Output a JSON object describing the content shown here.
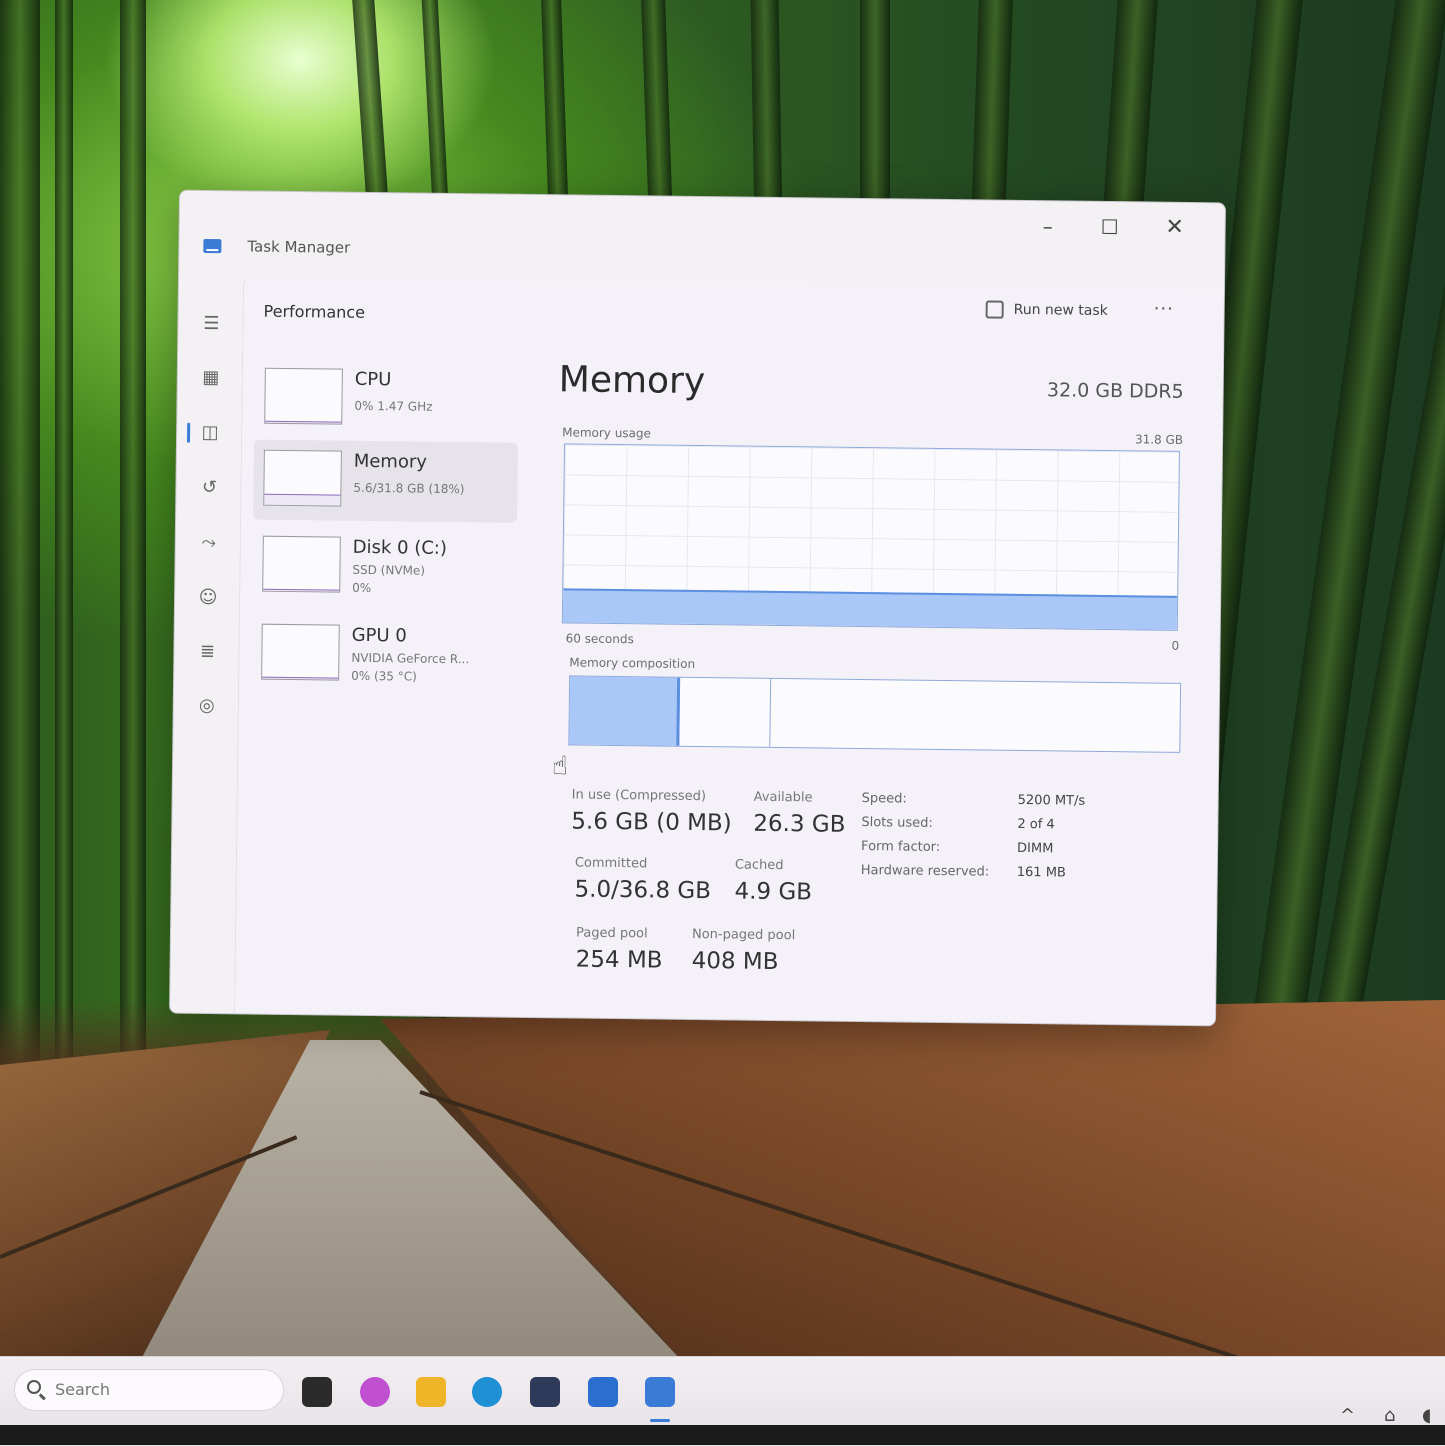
{
  "window": {
    "title": "Task Manager",
    "minimize": "–",
    "maximize": "☐",
    "close": "✕"
  },
  "header": {
    "title": "Performance",
    "run_new_task": "Run new task",
    "more": "···"
  },
  "nav_icons": [
    "hamburger-icon",
    "processes-icon",
    "performance-icon",
    "app-history-icon",
    "startup-icon",
    "users-icon",
    "details-icon",
    "services-icon",
    "settings-icon"
  ],
  "side_list": [
    {
      "name": "CPU",
      "line1": "0% 1.47 GHz",
      "line2": "",
      "fill": 0.02
    },
    {
      "name": "Memory",
      "line1": "5.6/31.8 GB (18%)",
      "line2": "",
      "fill": 0.18
    },
    {
      "name": "Disk 0 (C:)",
      "line1": "SSD (NVMe)",
      "line2": "0%",
      "fill": 0.0
    },
    {
      "name": "GPU 0",
      "line1": "NVIDIA GeForce R...",
      "line2": "0% (35 °C)",
      "fill": 0.0
    }
  ],
  "memory": {
    "title": "Memory",
    "type": "32.0 GB DDR5",
    "usage_label": "Memory usage",
    "usage_max": "31.8 GB",
    "usage_fraction": 0.18,
    "time_left": "60 seconds",
    "time_right": "0",
    "composition_label": "Memory composition",
    "composition": {
      "in_use": 0.18,
      "modified": 0.15
    },
    "stats": {
      "in_use_label": "In use (Compressed)",
      "in_use": "5.6 GB (0 MB)",
      "available_label": "Available",
      "available": "26.3 GB",
      "committed_label": "Committed",
      "committed": "5.0/36.8 GB",
      "cached_label": "Cached",
      "cached": "4.9 GB",
      "paged_label": "Paged pool",
      "paged": "254 MB",
      "nonpaged_label": "Non-paged pool",
      "nonpaged": "408 MB"
    },
    "details": [
      {
        "key": "Speed:",
        "value": "5200 MT/s"
      },
      {
        "key": "Slots used:",
        "value": "2 of 4"
      },
      {
        "key": "Form factor:",
        "value": "DIMM"
      },
      {
        "key": "Hardware reserved:",
        "value": "161 MB"
      }
    ]
  },
  "taskbar": {
    "search_placeholder": "Search",
    "apps": [
      {
        "name": "widgets-icon",
        "color": "#2b2b2b"
      },
      {
        "name": "copilot-icon",
        "color": "#c050d0"
      },
      {
        "name": "file-explorer-icon",
        "color": "#f0b429"
      },
      {
        "name": "edge-icon",
        "color": "#1f8fd6"
      },
      {
        "name": "store-icon",
        "color": "#2d3a5a"
      },
      {
        "name": "app-icon",
        "color": "#2a6fd0"
      },
      {
        "name": "task-manager-icon",
        "color": "#3a7bd5"
      }
    ],
    "tray_chevron": "^"
  }
}
